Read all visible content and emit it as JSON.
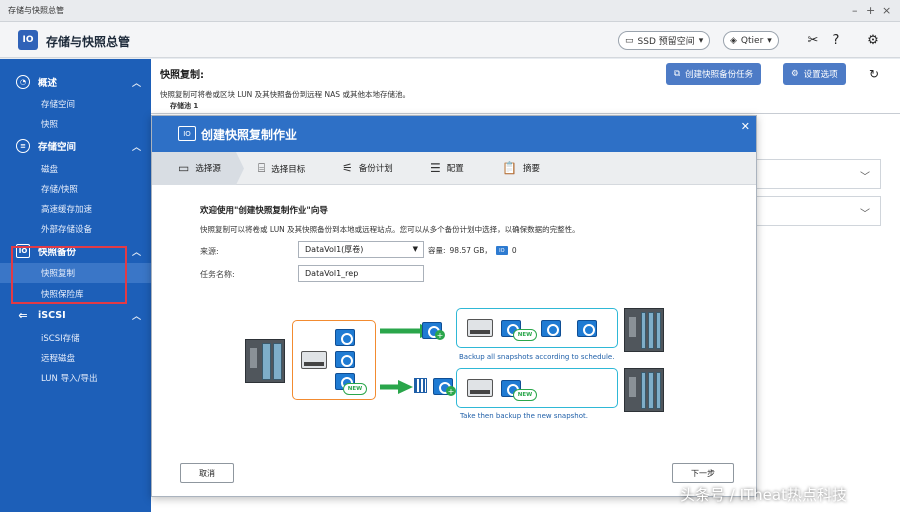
{
  "window": {
    "title": "存储与快照总管"
  },
  "header": {
    "app_title": "存储与快照总管",
    "ssd_label": "SSD 预留空间",
    "user_label": "Qtier"
  },
  "sidebar": {
    "sections": [
      {
        "label": "概述",
        "items": [
          "存储空间",
          "快照"
        ]
      },
      {
        "label": "存储空间",
        "items": [
          "磁盘",
          "存储/快照",
          "高速缓存加速",
          "外部存储设备"
        ]
      },
      {
        "label": "快照备份",
        "items": [
          "快照复制",
          "快照保险库"
        ]
      },
      {
        "label": "iSCSI",
        "items": [
          "iSCSI存储",
          "远程磁盘",
          "LUN 导入/导出"
        ]
      }
    ]
  },
  "page": {
    "title": "快照复制:",
    "description": "快照复制可将卷或区块 LUN 及其快照备份到远程 NAS 或其他本地存储池。",
    "tab": "存储池 1",
    "create_button": "创建快照备份任务",
    "settings_button": "设置选项"
  },
  "modal": {
    "title": "创建快照复制作业",
    "steps": [
      "选择源",
      "选择目标",
      "备份计划",
      "配置",
      "摘要"
    ],
    "welcome": "欢迎使用\"创建快照复制作业\"向导",
    "intro": "快照复制可以将卷或 LUN 及其快照备份到本地或远程站点。您可以从多个备份计划中选择，以确保数据的完整性。",
    "source_label": "来源:",
    "source_value": "DataVol1(厚卷)",
    "capacity_label": "容量:",
    "capacity_value": "98.57 GB，",
    "snapshot_count": "0",
    "taskname_label": "任务名称:",
    "taskname_value": "DataVol1_rep",
    "diagram": {
      "new_badge": "NEW",
      "caption_top": "Backup all snapshots according to schedule.",
      "caption_bottom": "Take then backup the new snapshot."
    },
    "cancel": "取消",
    "next": "下一步"
  },
  "watermark": "头条号 / ITheat热点科技"
}
